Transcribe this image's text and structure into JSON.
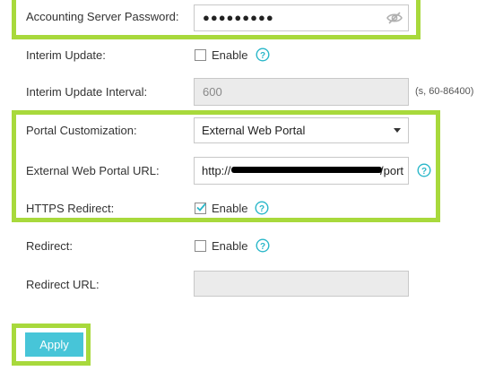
{
  "accounting_password": {
    "label": "Accounting Server Password:",
    "value": "●●●●●●●●●",
    "toggle_icon": "eye-slash-icon"
  },
  "interim_update": {
    "label": "Interim Update:",
    "checkbox_label": "Enable",
    "checked": false
  },
  "interim_update_interval": {
    "label": "Interim Update Interval:",
    "value": "600",
    "hint": "(s, 60-86400)"
  },
  "portal_customization": {
    "label": "Portal Customization:",
    "selected": "External Web Portal"
  },
  "external_web_portal_url": {
    "label": "External Web Portal URL:",
    "value_prefix": "http://",
    "value_suffix": "/port"
  },
  "https_redirect": {
    "label": "HTTPS Redirect:",
    "checkbox_label": "Enable",
    "checked": true
  },
  "redirect": {
    "label": "Redirect:",
    "checkbox_label": "Enable",
    "checked": false
  },
  "redirect_url": {
    "label": "Redirect URL:",
    "value": ""
  },
  "apply_button": {
    "label": "Apply"
  },
  "colors": {
    "accent": "#2ab7c9",
    "highlight": "#a8d93c",
    "button": "#47c5d8"
  }
}
